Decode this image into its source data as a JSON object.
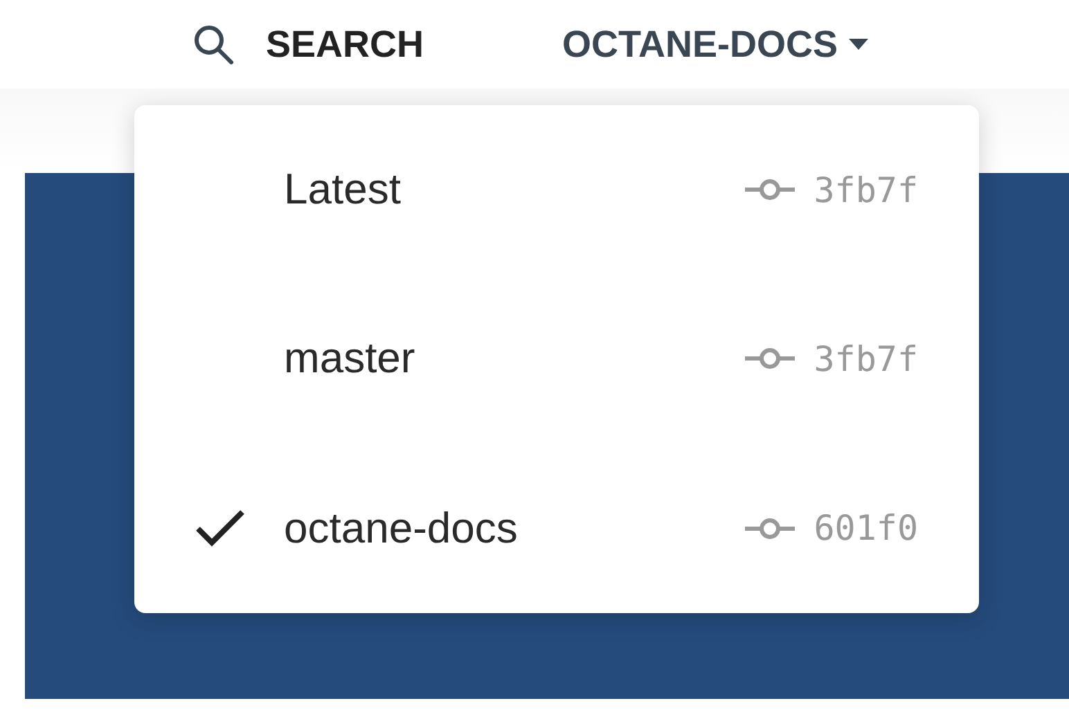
{
  "header": {
    "search_label": "SEARCH",
    "version_label": "OCTANE-DOCS"
  },
  "versions": [
    {
      "name": "Latest",
      "commit": "3fb7f",
      "selected": false
    },
    {
      "name": "master",
      "commit": "3fb7f",
      "selected": false
    },
    {
      "name": "octane-docs",
      "commit": "601f0",
      "selected": true
    }
  ]
}
